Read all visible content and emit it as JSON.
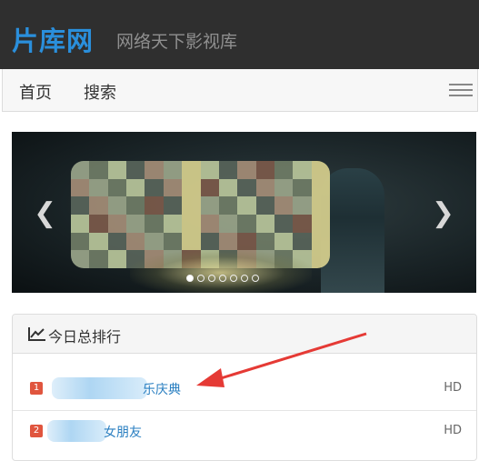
{
  "header": {
    "brand": "片库网",
    "tagline": "网络天下影视库"
  },
  "navbar": {
    "items": [
      "首页",
      "搜索"
    ],
    "menu_icon": "hamburger-icon"
  },
  "carousel": {
    "prev_icon": "chevron-left-icon",
    "next_icon": "chevron-right-icon",
    "indicator_count": 7,
    "active_index": 0
  },
  "ranking": {
    "title": "今日总排行",
    "icon": "line-chart-icon",
    "items": [
      {
        "rank": "1",
        "title": "乐庆典",
        "quality": "HD"
      },
      {
        "rank": "2",
        "title": "女朋友",
        "quality": "HD"
      }
    ]
  },
  "colors": {
    "brand": "#2a8fdc",
    "header_bg": "#2f2f2f",
    "rank_badge": "#e0553e",
    "link": "#2a7fc1",
    "annotation_arrow": "#e53a35"
  }
}
